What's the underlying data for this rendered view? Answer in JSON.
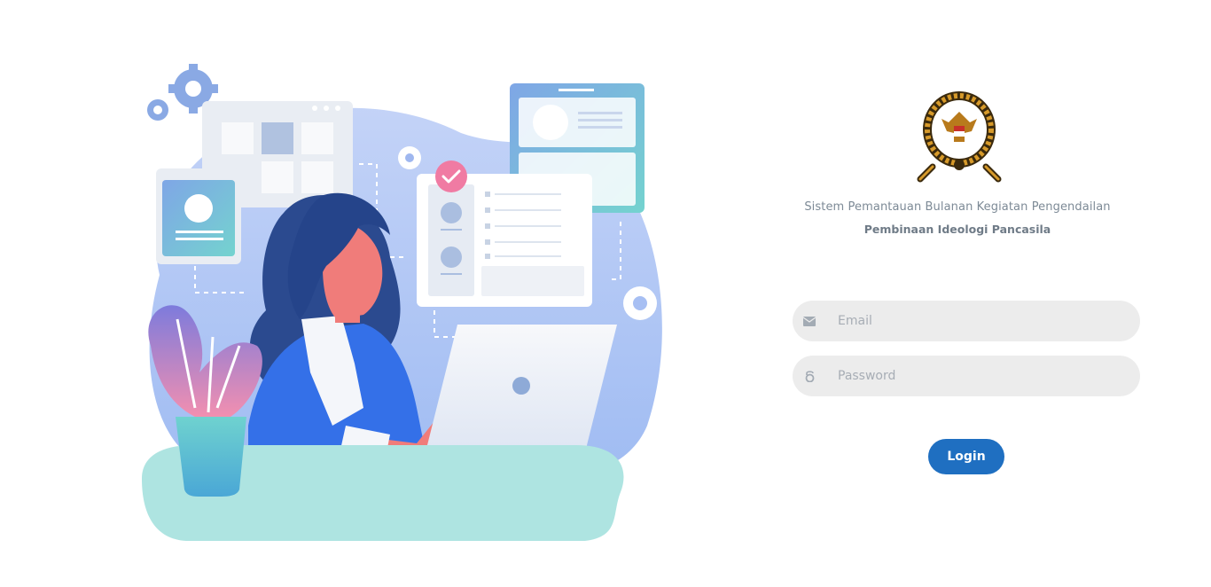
{
  "subtitle": "Sistem Pemantauan Bulanan Kegiatan Pengendailan",
  "title": "Pembinaan Ideologi Pancasila",
  "form": {
    "email_placeholder": "Email",
    "password_placeholder": "Password",
    "login_label": "Login"
  },
  "icons": {
    "email": "envelope-icon",
    "password": "lock-icon",
    "logo": "garuda-emblem"
  },
  "colors": {
    "primary": "#1f6fc1",
    "field_bg": "#ececec",
    "text_muted": "#7d8a96"
  }
}
